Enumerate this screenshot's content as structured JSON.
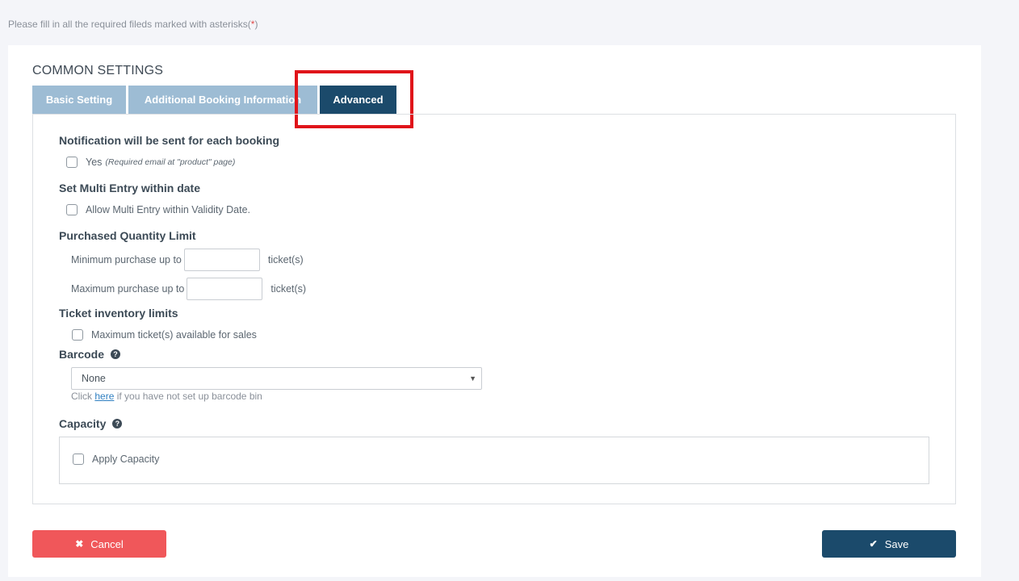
{
  "notice": {
    "text": "Please fill in all the required fileds marked with asterisks(",
    "asterisk": "*",
    "close": ")"
  },
  "section_title": "COMMON SETTINGS",
  "tabs": [
    {
      "label": "Basic Setting"
    },
    {
      "label": "Additional Booking Information"
    },
    {
      "label": "Advanced",
      "active": true
    }
  ],
  "notification": {
    "heading": "Notification will be sent for each booking",
    "checkbox_label": "Yes",
    "note": "(Required email at \"product\" page)"
  },
  "multi_entry": {
    "heading": "Set Multi Entry within date",
    "checkbox_label": "Allow Multi Entry within Validity Date."
  },
  "quantity_limit": {
    "heading": "Purchased Quantity Limit",
    "min_label": "Minimum purchase up to",
    "max_label": "Maximum purchase up to",
    "unit": "ticket(s)",
    "min_value": "",
    "max_value": ""
  },
  "inventory": {
    "heading": "Ticket inventory limits",
    "checkbox_label": "Maximum ticket(s) available for sales"
  },
  "barcode": {
    "heading": "Barcode",
    "help_icon": "question-circle-icon",
    "selected": "None",
    "hint_prefix": "Click ",
    "hint_link": "here",
    "hint_suffix": " if you have not set up barcode bin"
  },
  "capacity": {
    "heading": "Capacity",
    "help_icon": "question-circle-icon",
    "checkbox_label": "Apply Capacity"
  },
  "buttons": {
    "cancel_label": "Cancel",
    "cancel_icon": "times-icon",
    "save_label": "Save",
    "save_icon": "check-icon"
  },
  "colors": {
    "accent": "#1b4a6b",
    "tab_inactive": "#9dbcd4",
    "cancel": "#f0575a",
    "highlight": "#e0141a"
  }
}
